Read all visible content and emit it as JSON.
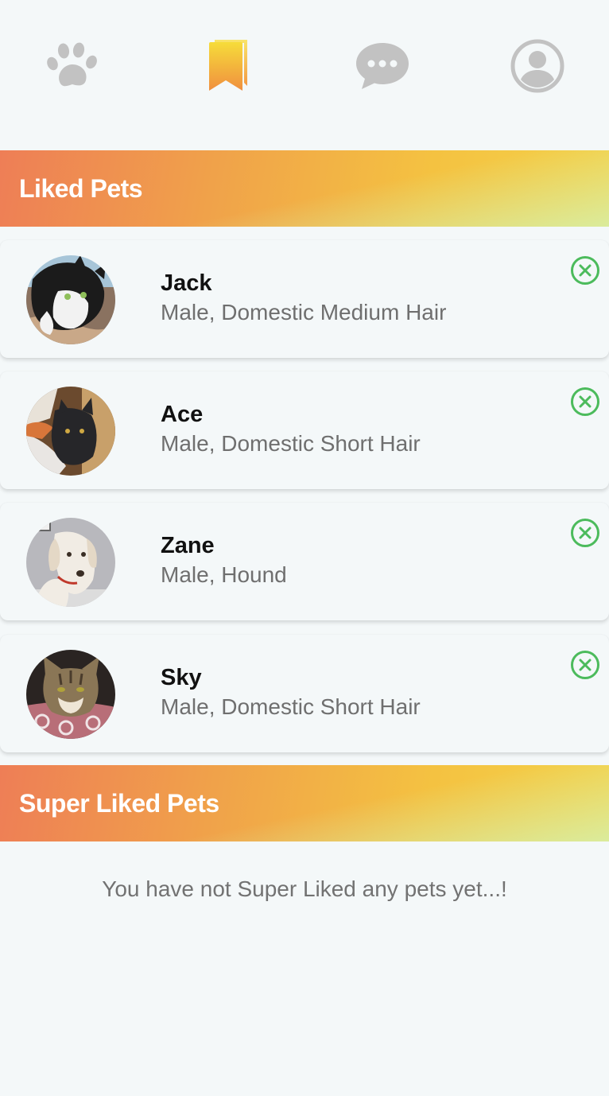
{
  "nav": {
    "items": [
      {
        "icon": "paw-icon",
        "active": false
      },
      {
        "icon": "bookmarks-icon",
        "active": true
      },
      {
        "icon": "chat-bubble-icon",
        "active": false
      },
      {
        "icon": "account-circle-icon",
        "active": false
      }
    ],
    "inactive_color": "#c2c2c2",
    "active_color_start": "#f08f3f",
    "active_color_end": "#f6dc3a"
  },
  "liked": {
    "title": "Liked Pets",
    "pets": [
      {
        "name": "Jack",
        "info": "Male, Domestic Medium Hair",
        "photo": "tuxedo-cat-photo"
      },
      {
        "name": "Ace",
        "info": "Male, Domestic Short Hair",
        "photo": "black-cat-photo"
      },
      {
        "name": "Zane",
        "info": "Male, Hound",
        "photo": "white-hound-dog-photo"
      },
      {
        "name": "Sky",
        "info": "Male, Domestic Short Hair",
        "photo": "tabby-cat-photo"
      }
    ],
    "remove_icon": "close-circle-icon",
    "remove_color": "#4cbb5c"
  },
  "super_liked": {
    "title": "Super Liked Pets",
    "empty_message": "You have not Super Liked any pets yet...!"
  }
}
